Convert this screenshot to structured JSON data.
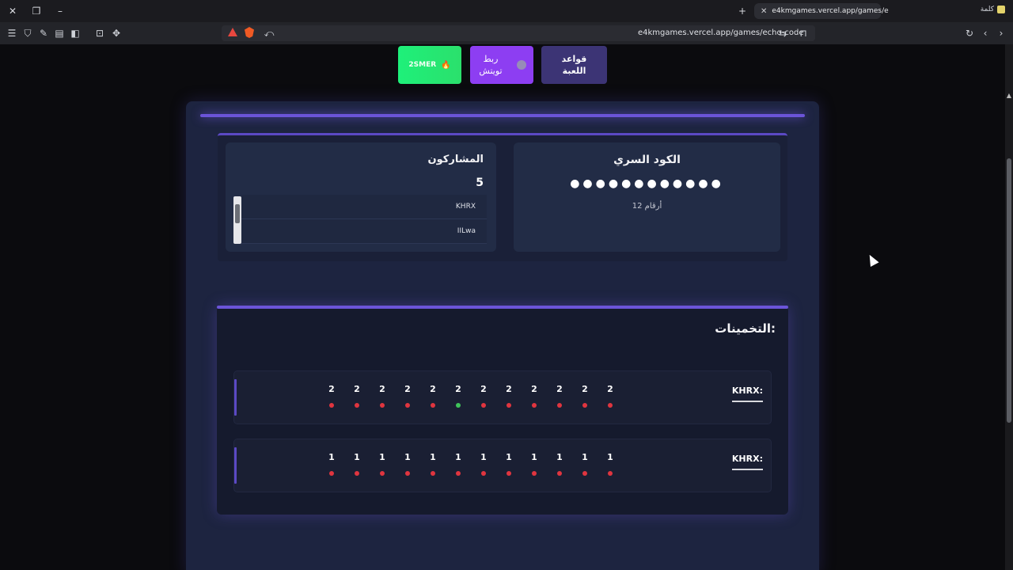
{
  "browser": {
    "tab_title": "e4kmgames.vercel.app/games/e",
    "right_label": "كلمة",
    "url": "e4kmgames.vercel.app/games/echo-code"
  },
  "top_buttons": {
    "rules": "قواعد اللعبة",
    "twitch": "ربط تويتش",
    "smer": "2SMER"
  },
  "secret": {
    "title": "الكود السري",
    "dots": "●●●●●●●●●●●●",
    "length_label": "12 أرقام"
  },
  "participants": {
    "title": "المشاركون",
    "count": "5",
    "list": [
      "KHRX",
      "IILwa"
    ]
  },
  "guesses": {
    "title": "التخمينات:",
    "rows": [
      {
        "player": "KHRX:",
        "digits": [
          "2",
          "2",
          "2",
          "2",
          "2",
          "2",
          "2",
          "2",
          "2",
          "2",
          "2",
          "2"
        ],
        "status": [
          "red",
          "red",
          "red",
          "red",
          "red",
          "green",
          "red",
          "red",
          "red",
          "red",
          "red",
          "red"
        ]
      },
      {
        "player": "KHRX:",
        "digits": [
          "1",
          "1",
          "1",
          "1",
          "1",
          "1",
          "1",
          "1",
          "1",
          "1",
          "1",
          "1"
        ],
        "status": [
          "red",
          "red",
          "red",
          "red",
          "red",
          "red",
          "red",
          "red",
          "red",
          "red",
          "red",
          "red"
        ]
      }
    ]
  },
  "colors": {
    "red": "#e0353f",
    "green": "#3fc45a",
    "accent": "#6b54d8"
  }
}
